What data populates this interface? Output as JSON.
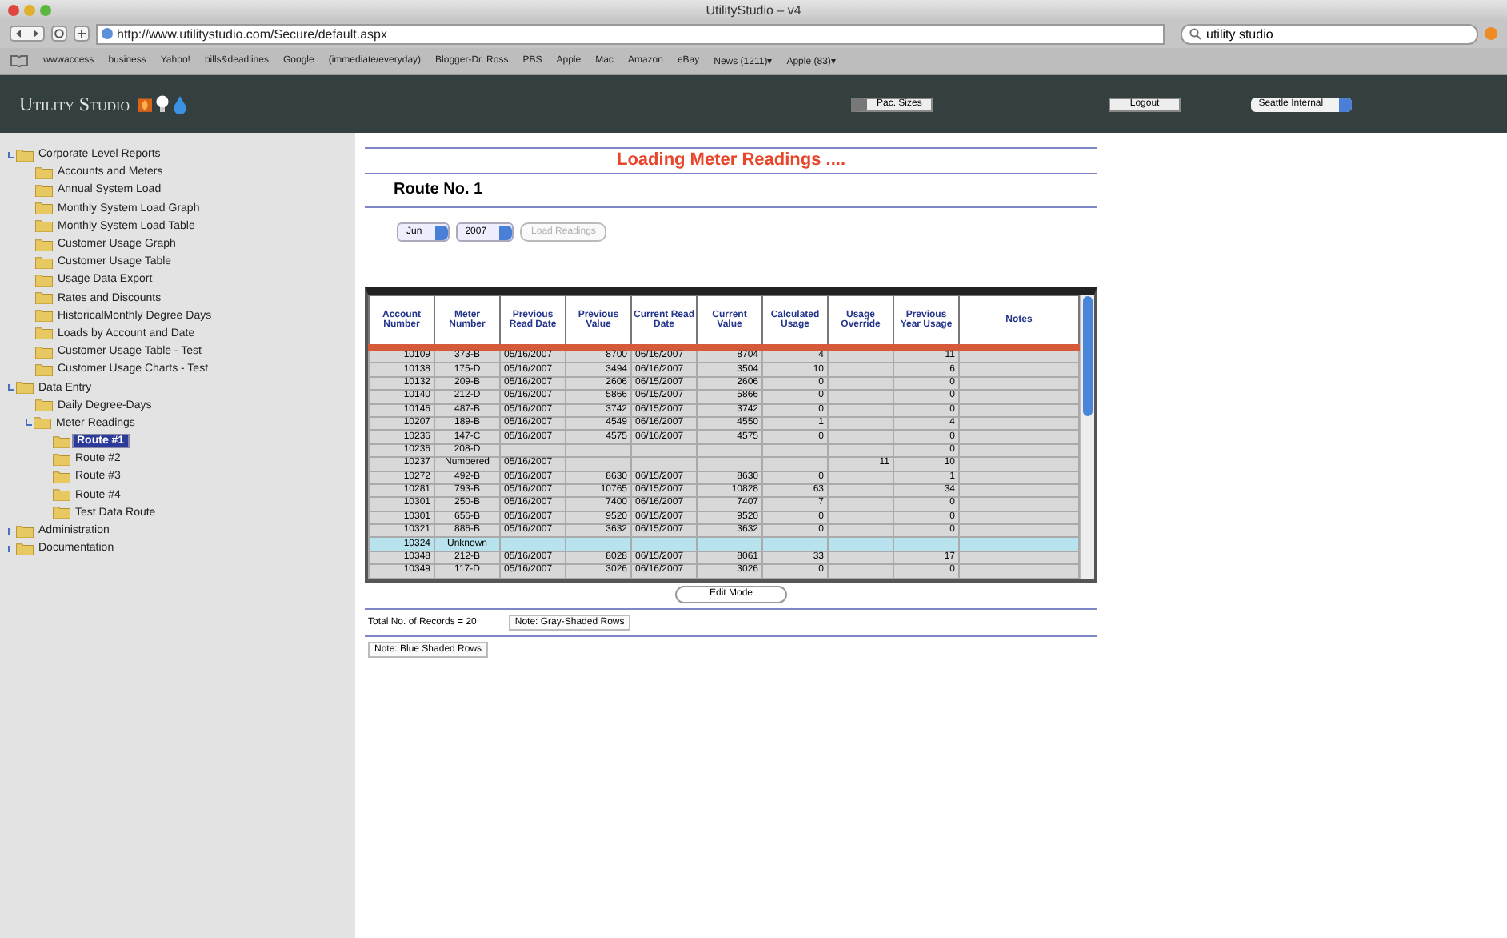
{
  "browser": {
    "title": "UtilityStudio – v4",
    "url": "http://www.utilitystudio.com/Secure/default.aspx",
    "search": "utility studio",
    "bookmarks": [
      "wwwaccess",
      "business",
      "Yahoo!",
      "bills&deadlines",
      "Google",
      "(immediate/everyday)",
      "Blogger-Dr. Ross",
      "PBS",
      "Apple",
      "Mac",
      "Amazon",
      "eBay",
      "News (1211)▾",
      "Apple (83)▾"
    ]
  },
  "header": {
    "logo": "Utility Studio",
    "tool_button": "Pac. Sizes",
    "logout": "Logout",
    "site_select": "Seattle Internal"
  },
  "sidebar": {
    "items": [
      {
        "label": "Corporate Level Reports",
        "expanded": true,
        "selected": false,
        "children": [
          {
            "label": "Accounts and Meters",
            "selected": false
          },
          {
            "label": "Annual System Load",
            "selected": false
          },
          {
            "label": "Monthly System Load Graph",
            "selected": false
          },
          {
            "label": "Monthly System Load Table",
            "selected": false
          },
          {
            "label": "Customer Usage Graph",
            "selected": false
          },
          {
            "label": "Customer Usage Table",
            "selected": false
          },
          {
            "label": "Usage Data Export",
            "selected": false
          },
          {
            "label": "Rates and Discounts",
            "selected": false
          },
          {
            "label": "HistoricalMonthly Degree Days",
            "selected": false
          },
          {
            "label": "Loads by Account and Date",
            "selected": false
          },
          {
            "label": "Customer Usage Table - Test",
            "selected": false
          },
          {
            "label": "Customer Usage Charts - Test",
            "selected": false
          }
        ]
      },
      {
        "label": "Data Entry",
        "expanded": true,
        "selected": false,
        "children": [
          {
            "label": "Daily Degree-Days",
            "selected": false
          },
          {
            "label": "Meter Readings",
            "expanded": true,
            "selected": false,
            "children": [
              {
                "label": "Route #1",
                "selected": true
              },
              {
                "label": "Route #2",
                "selected": false
              },
              {
                "label": "Route #3",
                "selected": false
              },
              {
                "label": "Route #4",
                "selected": false
              },
              {
                "label": "Test Data Route",
                "selected": false
              }
            ]
          }
        ]
      },
      {
        "label": "Administration",
        "expanded": false,
        "selected": false
      },
      {
        "label": "Documentation",
        "expanded": false,
        "selected": false
      }
    ]
  },
  "main": {
    "status": "Loading Meter Readings ....",
    "route_title": "Route No. 1",
    "month": "Jun",
    "year": "2007",
    "load_button": {
      "label": "Load Readings",
      "disabled": true
    },
    "table": {
      "columns": [
        "Account Number",
        "Meter Number",
        "Previous Read Date",
        "Previous Value",
        "Current Read Date",
        "Current Value",
        "Calculated Usage",
        "Usage Override",
        "Previous Year Usage",
        "Notes"
      ],
      "rows": [
        {
          "selected": false,
          "cells": [
            "10109",
            "373-B",
            "05/16/2007",
            "8700",
            "06/16/2007",
            "8704",
            "4",
            null,
            "11",
            null
          ]
        },
        {
          "selected": false,
          "cells": [
            "10138",
            "175-D",
            "05/16/2007",
            "3494",
            "06/16/2007",
            "3504",
            "10",
            null,
            "6",
            null
          ]
        },
        {
          "selected": false,
          "cells": [
            "10132",
            "209-B",
            "05/16/2007",
            "2606",
            "06/15/2007",
            "2606",
            "0",
            null,
            "0",
            null
          ]
        },
        {
          "selected": false,
          "cells": [
            "10140",
            "212-D",
            "05/16/2007",
            "5866",
            "06/15/2007",
            "5866",
            "0",
            null,
            "0",
            null
          ]
        },
        {
          "selected": false,
          "cells": [
            "10146",
            "487-B",
            "05/16/2007",
            "3742",
            "06/15/2007",
            "3742",
            "0",
            null,
            "0",
            null
          ]
        },
        {
          "selected": false,
          "cells": [
            "10207",
            "189-B",
            "05/16/2007",
            "4549",
            "06/16/2007",
            "4550",
            "1",
            null,
            "4",
            null
          ]
        },
        {
          "selected": false,
          "cells": [
            "10236",
            "147-C",
            "05/16/2007",
            "4575",
            "06/16/2007",
            "4575",
            "0",
            null,
            "0",
            null
          ]
        },
        {
          "selected": false,
          "cells": [
            "10236",
            "208-D",
            null,
            null,
            null,
            null,
            null,
            null,
            "0",
            null
          ]
        },
        {
          "selected": false,
          "cells": [
            "10237",
            "Numbered",
            "05/16/2007",
            null,
            null,
            null,
            null,
            "11",
            "10",
            null
          ]
        },
        {
          "selected": false,
          "cells": [
            "10272",
            "492-B",
            "05/16/2007",
            "8630",
            "06/15/2007",
            "8630",
            "0",
            null,
            "1",
            null
          ]
        },
        {
          "selected": false,
          "cells": [
            "10281",
            "793-B",
            "05/16/2007",
            "10765",
            "06/15/2007",
            "10828",
            "63",
            null,
            "34",
            null
          ]
        },
        {
          "selected": false,
          "cells": [
            "10301",
            "250-B",
            "05/16/2007",
            "7400",
            "06/16/2007",
            "7407",
            "7",
            null,
            "0",
            null
          ]
        },
        {
          "selected": false,
          "cells": [
            "10301",
            "656-B",
            "05/16/2007",
            "9520",
            "06/15/2007",
            "9520",
            "0",
            null,
            "0",
            null
          ]
        },
        {
          "selected": false,
          "cells": [
            "10321",
            "886-B",
            "05/16/2007",
            "3632",
            "06/15/2007",
            "3632",
            "0",
            null,
            "0",
            null
          ]
        },
        {
          "selected": true,
          "cells": [
            "10324",
            "Unknown",
            null,
            null,
            null,
            null,
            null,
            null,
            null,
            null
          ]
        },
        {
          "selected": false,
          "cells": [
            "10348",
            "212-B",
            "05/16/2007",
            "8028",
            "06/15/2007",
            "8061",
            "33",
            null,
            "17",
            null
          ]
        },
        {
          "selected": false,
          "cells": [
            "10349",
            "117-D",
            "05/16/2007",
            "3026",
            "06/16/2007",
            "3026",
            "0",
            null,
            "0",
            null
          ]
        }
      ]
    },
    "edit_button": "Edit Mode",
    "total": "Total No. of Records = 20",
    "notes": [
      "Note: Gray-Shaded Rows",
      "Note: Blue Shaded Rows"
    ]
  }
}
